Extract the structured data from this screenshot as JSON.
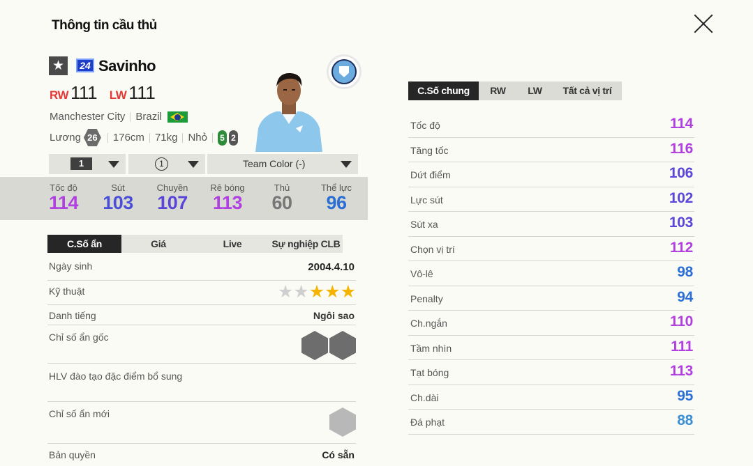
{
  "header": {
    "title": "Thông tin cầu thủ",
    "close_icon": "close-icon"
  },
  "player": {
    "star_icon": "★",
    "season_badge": "24",
    "name": "Savinho",
    "positions": [
      {
        "pos": "RW",
        "ovr": "111"
      },
      {
        "pos": "LW",
        "ovr": "111"
      }
    ],
    "club": "Manchester City",
    "nation": "Brazil",
    "salary_label": "Lương",
    "salary": "26",
    "height": "176cm",
    "weight": "71kg",
    "body_type": "Nhỏ",
    "foot_left": "5",
    "foot_right": "2",
    "colors": {
      "left_foot": "#2e8b3a",
      "right_foot": "#555555"
    }
  },
  "selectors": {
    "upgrade_level": "1",
    "rank": "1",
    "team_color": "Team Color (-)"
  },
  "summary_stats": [
    {
      "label": "Tốc độ",
      "value": "114",
      "color": "#b040e0"
    },
    {
      "label": "Sút",
      "value": "103",
      "color": "#4a4fd8"
    },
    {
      "label": "Chuyền",
      "value": "107",
      "color": "#5a46d8"
    },
    {
      "label": "Rê bóng",
      "value": "113",
      "color": "#b040e0"
    },
    {
      "label": "Thủ",
      "value": "60",
      "color": "#777777"
    },
    {
      "label": "Thể lực",
      "value": "96",
      "color": "#2b6fd6"
    }
  ],
  "left_tabs": [
    {
      "label": "C.Số ẩn",
      "active": true
    },
    {
      "label": "Giá",
      "active": false
    },
    {
      "label": "Live",
      "active": false
    },
    {
      "label": "Sự nghiệp CLB",
      "active": false
    }
  ],
  "details": {
    "birth_label": "Ngày sinh",
    "birth": "2004.4.10",
    "skill_label": "Kỹ thuật",
    "skill_stars": 3,
    "skill_max": 5,
    "fame_label": "Danh tiếng",
    "fame": "Ngôi sao",
    "traits_label": "Chỉ số ẩn gốc",
    "traits": [
      "speed-dribbler-trait-icon",
      "flair-trait-icon"
    ],
    "coach_label": "HLV đào tạo đặc điểm bổ sung",
    "new_traits_label": "Chỉ số ẩn mới",
    "license_label": "Bản quyền",
    "license": "Có sẵn"
  },
  "right_tabs": [
    {
      "label": "C.Số chung",
      "active": true
    },
    {
      "label": "RW",
      "active": false
    },
    {
      "label": "LW",
      "active": false
    },
    {
      "label": "Tất cả vị trí",
      "active": false
    }
  ],
  "attributes": [
    {
      "label": "Tốc độ",
      "value": "114",
      "color": "#b040e0"
    },
    {
      "label": "Tăng tốc",
      "value": "116",
      "color": "#b040e0"
    },
    {
      "label": "Dứt điểm",
      "value": "106",
      "color": "#5a46d8"
    },
    {
      "label": "Lực sút",
      "value": "102",
      "color": "#5a46d8"
    },
    {
      "label": "Sút xa",
      "value": "103",
      "color": "#5a46d8"
    },
    {
      "label": "Chọn vị trí",
      "value": "112",
      "color": "#b040e0"
    },
    {
      "label": "Vô-lê",
      "value": "98",
      "color": "#2b6fd6"
    },
    {
      "label": "Penalty",
      "value": "94",
      "color": "#2b6fd6"
    },
    {
      "label": "Ch.ngắn",
      "value": "110",
      "color": "#b040e0"
    },
    {
      "label": "Tầm nhìn",
      "value": "111",
      "color": "#b040e0"
    },
    {
      "label": "Tạt bóng",
      "value": "113",
      "color": "#b040e0"
    },
    {
      "label": "Ch.dài",
      "value": "95",
      "color": "#2b6fd6"
    },
    {
      "label": "Đá phạt",
      "value": "88",
      "color": "#3a8fd6"
    }
  ]
}
